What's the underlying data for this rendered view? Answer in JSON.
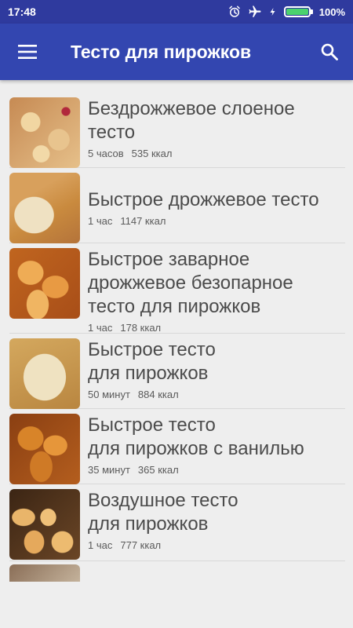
{
  "status_bar": {
    "time": "17:48",
    "battery_text": "100%",
    "icons": [
      "alarm-icon",
      "airplane-icon",
      "charging-icon",
      "battery-icon"
    ]
  },
  "app_bar": {
    "title": "Тесто для пирожков",
    "menu_icon": "hamburger-menu-icon",
    "search_icon": "search-icon"
  },
  "recipes": [
    {
      "title": "Бездрожжевое слоеное\nтесто",
      "time": "5 часов",
      "kcal": "535 ккал"
    },
    {
      "title": "Быстрое дрожжевое тесто",
      "time": "1 час",
      "kcal": "1147 ккал"
    },
    {
      "title": "Быстрое заварное\nдрожжевое безопарное\nтесто для пирожков",
      "time": "1 час",
      "kcal": "178 ккал"
    },
    {
      "title": "Быстрое тесто\nдля пирожков",
      "time": "50 минут",
      "kcal": "884 ккал"
    },
    {
      "title": "Быстрое тесто\nдля пирожков с ванилью",
      "time": "35 минут",
      "kcal": "365 ккал"
    },
    {
      "title": "Воздушное тесто\nдля пирожков",
      "time": "1 час",
      "kcal": "777 ккал"
    }
  ],
  "colors": {
    "app_bar": "#3346b0",
    "status_bar": "#2f3a9e",
    "background": "#eeeeee",
    "battery_fill": "#4bd26e"
  }
}
